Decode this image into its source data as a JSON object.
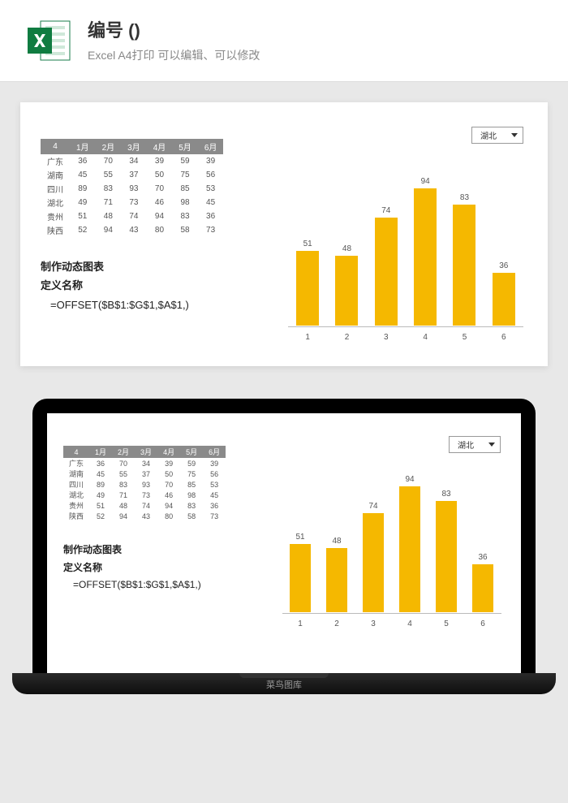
{
  "header": {
    "title": "编号 ()",
    "subtitle": "Excel A4打印 可以编辑、可以修改"
  },
  "table": {
    "corner": "4",
    "headers": [
      "1月",
      "2月",
      "3月",
      "4月",
      "5月",
      "6月"
    ],
    "rows": [
      {
        "name": "广东",
        "vals": [
          36,
          70,
          34,
          39,
          59,
          39
        ]
      },
      {
        "name": "湖南",
        "vals": [
          45,
          55,
          37,
          50,
          75,
          56
        ]
      },
      {
        "name": "四川",
        "vals": [
          89,
          83,
          93,
          70,
          85,
          53
        ]
      },
      {
        "name": "湖北",
        "vals": [
          49,
          71,
          73,
          46,
          98,
          45
        ]
      },
      {
        "name": "贵州",
        "vals": [
          51,
          48,
          74,
          94,
          83,
          36
        ]
      },
      {
        "name": "陕西",
        "vals": [
          52,
          94,
          43,
          80,
          58,
          73
        ]
      }
    ]
  },
  "notes": {
    "line1": "制作动态图表",
    "line2": "定义名称",
    "formula": "=OFFSET($B$1:$G$1,$A$1,)"
  },
  "dropdown": {
    "selected": "湖北"
  },
  "chart_data": {
    "type": "bar",
    "categories": [
      "1",
      "2",
      "3",
      "4",
      "5",
      "6"
    ],
    "values": [
      51,
      48,
      74,
      94,
      83,
      36
    ],
    "title": "",
    "xlabel": "",
    "ylabel": "",
    "ylim": [
      0,
      100
    ],
    "bar_color": "#f5b800"
  },
  "watermark": "菜鸟图库"
}
